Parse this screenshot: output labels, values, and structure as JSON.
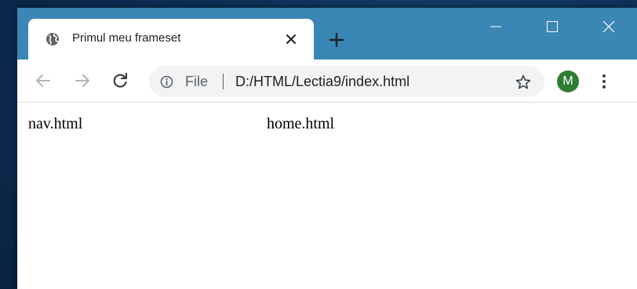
{
  "tab": {
    "title": "Primul meu frameset",
    "favicon": "globe-icon"
  },
  "address_bar": {
    "security_label": "File",
    "url": "D:/HTML/Lectia9/index.html"
  },
  "profile": {
    "initial": "M",
    "color": "#2e7d32"
  },
  "frames": {
    "nav": "nav.html",
    "main": "home.html"
  },
  "colors": {
    "titlebar": "#3a86b5",
    "desktop": "#0d3158"
  }
}
